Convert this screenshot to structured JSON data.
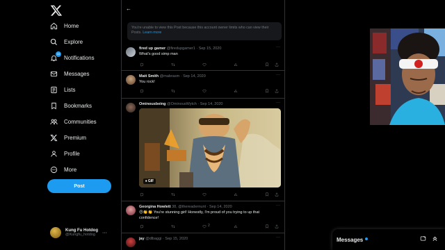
{
  "nav": {
    "items": [
      {
        "label": "Home",
        "icon": "home-icon"
      },
      {
        "label": "Explore",
        "icon": "search-icon"
      },
      {
        "label": "Notifications",
        "icon": "bell-icon",
        "badge": "10"
      },
      {
        "label": "Messages",
        "icon": "mail-icon"
      },
      {
        "label": "Lists",
        "icon": "list-icon"
      },
      {
        "label": "Bookmarks",
        "icon": "bookmark-icon"
      },
      {
        "label": "Communities",
        "icon": "people-icon"
      },
      {
        "label": "Premium",
        "icon": "x-logo-icon"
      },
      {
        "label": "Profile",
        "icon": "person-icon"
      },
      {
        "label": "More",
        "icon": "more-circle-icon"
      }
    ],
    "post_label": "Post"
  },
  "account": {
    "display_name": "Kung Fu Hotdog",
    "handle": "@Kungfu_hotdog",
    "more": "···"
  },
  "notice": {
    "text": "You're unable to view this Post because this account owner limits who can view their Posts.",
    "link": "Learn more"
  },
  "tweets": [
    {
      "name": "fired up gamer",
      "handle": "@firedupgamer1",
      "date": "Sep 15, 2020",
      "text": "What's good simp man",
      "more": "···"
    },
    {
      "name": "Matt Smith",
      "handle": "@mabrasm",
      "date": "Sep 14, 2020",
      "text": "You rock!",
      "more": "···"
    },
    {
      "name": "Ominousbeing",
      "handle": "@OminousWytch",
      "date": "Sep 14, 2020",
      "text": "",
      "more": "···",
      "media_label": "GIF"
    },
    {
      "name": "Georgina Howlett",
      "handle": "38, @thereadernunt",
      "date": "Sep 14, 2020",
      "text": "😍👏👏 You're stunning girl! Honestly, I'm proud of you trying to up that confidence!",
      "more": "···",
      "like_count": "2"
    },
    {
      "name": "jay",
      "handle": "@dlbaggi",
      "date": "Sep 15, 2020",
      "text": "",
      "more": "···"
    }
  ],
  "messages_drawer": {
    "title": "Messages"
  },
  "colors": {
    "accent": "#1d9bf0",
    "background": "#000000",
    "muted": "#71767b",
    "border": "#2f3336"
  }
}
